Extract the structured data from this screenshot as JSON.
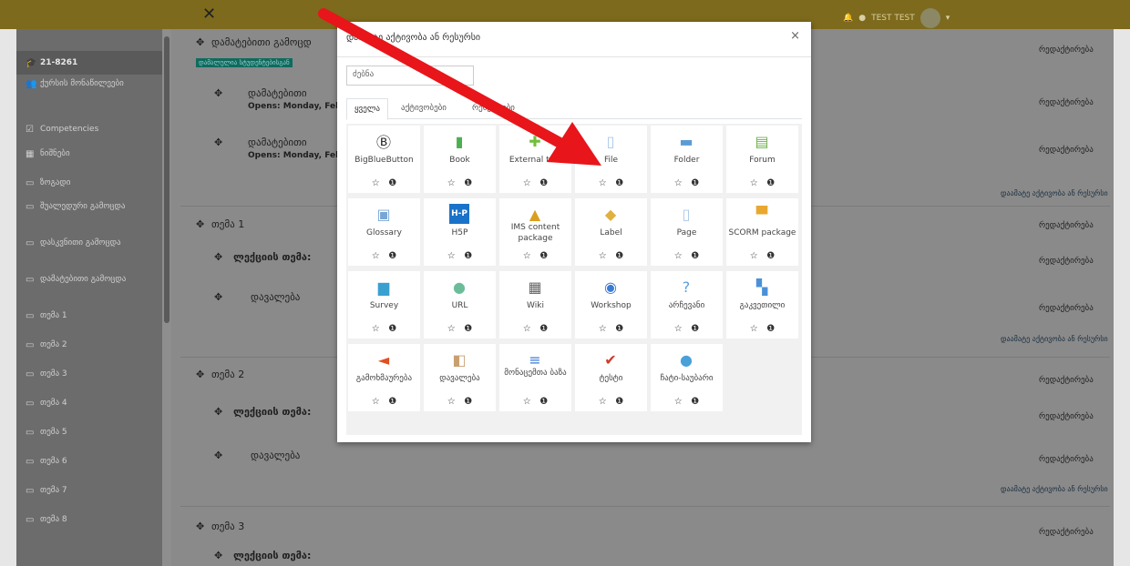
{
  "topbar": {
    "close_icon": "close-icon",
    "user_name": "TEST TEST"
  },
  "sidebar": {
    "course_code": "21-8261",
    "items": [
      {
        "label": "ქურსის მონაწილეები",
        "icon": "users-icon"
      },
      {
        "label": "Competencies",
        "icon": "checkbox-icon"
      },
      {
        "label": "ნიშნები",
        "icon": "grid-icon"
      },
      {
        "label": "ზოგადი",
        "icon": "folder-icon"
      },
      {
        "label": "შუალედური გამოცდა",
        "icon": "folder-icon"
      },
      {
        "label": "დასკვნითი გამოცდა",
        "icon": "folder-icon"
      },
      {
        "label": "დამატებითი გამოცდა",
        "icon": "folder-icon"
      },
      {
        "label": "თემა 1",
        "icon": "folder-icon"
      },
      {
        "label": "თემა 2",
        "icon": "folder-icon"
      },
      {
        "label": "თემა 3",
        "icon": "folder-icon"
      },
      {
        "label": "თემა 4",
        "icon": "folder-icon"
      },
      {
        "label": "თემა 5",
        "icon": "folder-icon"
      },
      {
        "label": "თემა 6",
        "icon": "folder-icon"
      },
      {
        "label": "თემა 7",
        "icon": "folder-icon"
      },
      {
        "label": "თემა 8",
        "icon": "folder-icon"
      }
    ]
  },
  "main": {
    "section_title": "დამატებითი გამოცდ",
    "badge": "დამალულია სტუდენტებისგან",
    "item1": "დამატებითი",
    "opens": "Opens: Monday, Febr",
    "topic1": "თემა 1",
    "topic2": "თემა 2",
    "topic3": "თემა 3",
    "lecture_topic": "ლექციის თემა:",
    "assignment": "დავალება",
    "edit_label": "რედაქტირება",
    "add_activity": "დაამატე აქტივობა ან რესურსი"
  },
  "modal": {
    "title": "დაამატე აქტივობა ან რესურსი",
    "search_placeholder": "ძებნა",
    "tabs": [
      "ყველა",
      "აქტივობები",
      "რესურსები"
    ],
    "star": "☆",
    "info": "❶",
    "tiles": [
      {
        "name": "BigBlueButton",
        "icon": "bigbluebutton-icon",
        "color": "#222"
      },
      {
        "name": "Book",
        "icon": "book-icon",
        "color": "#4caf50"
      },
      {
        "name": "External tool",
        "icon": "puzzle-icon",
        "color": "#6fbf3a"
      },
      {
        "name": "File",
        "icon": "file-icon",
        "color": "#a8c8e8"
      },
      {
        "name": "Folder",
        "icon": "folder-icon",
        "color": "#5a9bd5"
      },
      {
        "name": "Forum",
        "icon": "forum-icon",
        "color": "#6cb24a"
      },
      {
        "name": "Glossary",
        "icon": "glossary-icon",
        "color": "#7aa6d6"
      },
      {
        "name": "H5P",
        "icon": "h5p-icon",
        "color": "#1a73c9"
      },
      {
        "name": "IMS content package",
        "icon": "ims-icon",
        "color": "#d9a020"
      },
      {
        "name": "Label",
        "icon": "label-icon",
        "color": "#e0b040"
      },
      {
        "name": "Page",
        "icon": "page-icon",
        "color": "#a8c8e8"
      },
      {
        "name": "SCORM package",
        "icon": "scorm-icon",
        "color": "#e8a830"
      },
      {
        "name": "Survey",
        "icon": "survey-icon",
        "color": "#3aa0d0"
      },
      {
        "name": "URL",
        "icon": "url-icon",
        "color": "#6bbd9a"
      },
      {
        "name": "Wiki",
        "icon": "wiki-icon",
        "color": "#666"
      },
      {
        "name": "Workshop",
        "icon": "workshop-icon",
        "color": "#3a7bd5"
      },
      {
        "name": "არჩევანი",
        "icon": "question-icon",
        "color": "#5aa0e0"
      },
      {
        "name": "გაკვეთილი",
        "icon": "lesson-icon",
        "color": "#4a90d9"
      },
      {
        "name": "გამოხმაურება",
        "icon": "megaphone-icon",
        "color": "#e05020"
      },
      {
        "name": "დავალება",
        "icon": "assignment-icon",
        "color": "#c8a070"
      },
      {
        "name": "მონაცემთა ბაზა",
        "icon": "database-icon",
        "color": "#3a7bd5"
      },
      {
        "name": "ტესტი",
        "icon": "quiz-icon",
        "color": "#d03a2a"
      },
      {
        "name": "ჩატი-საუბარი",
        "icon": "chat-icon",
        "color": "#4aa0d8"
      }
    ]
  }
}
